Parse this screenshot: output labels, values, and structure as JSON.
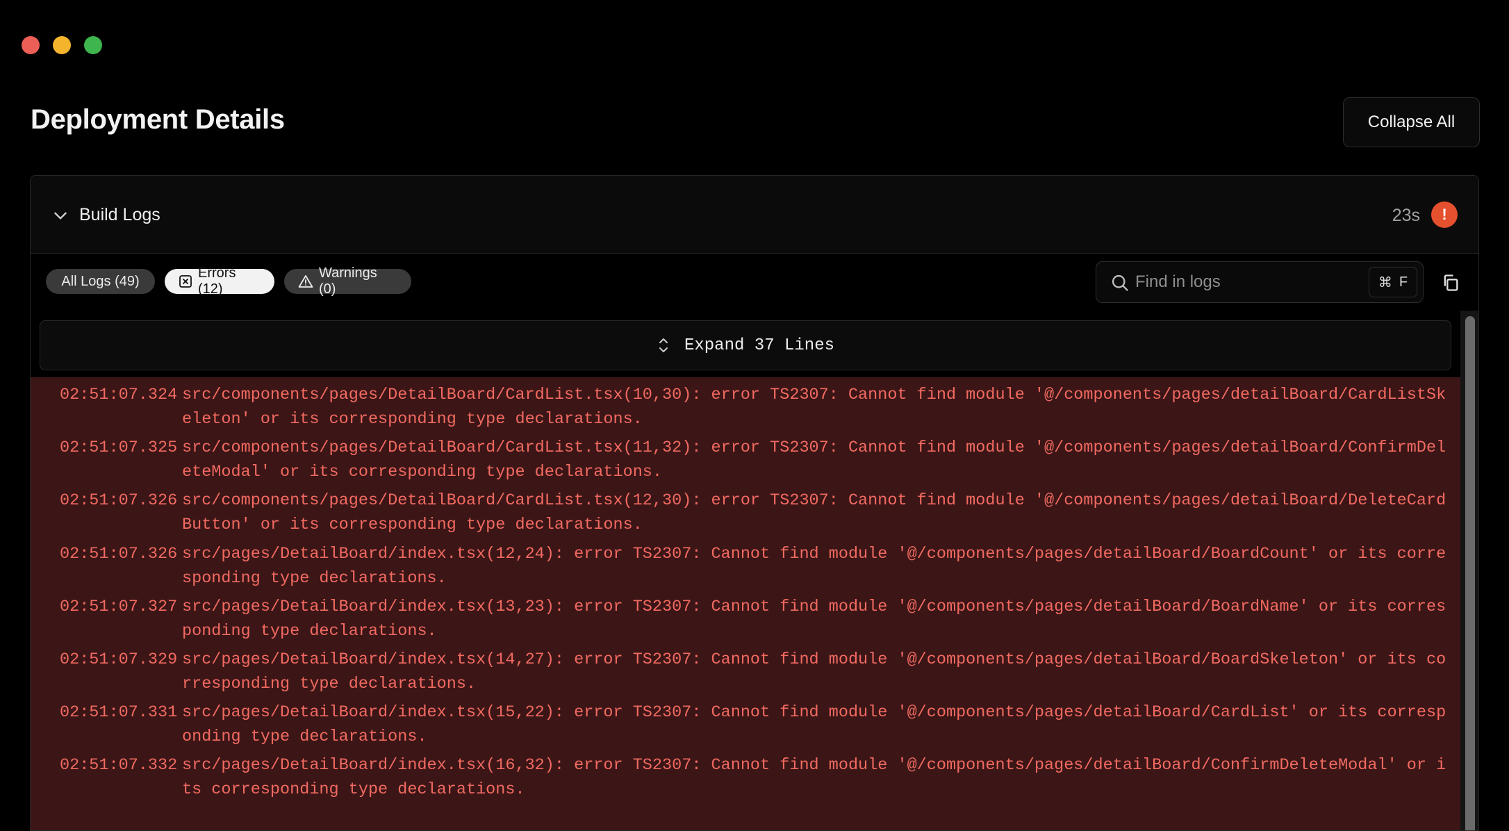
{
  "window": {
    "controls": [
      "close",
      "minimize",
      "zoom"
    ]
  },
  "page": {
    "title": "Deployment Details"
  },
  "toolbar": {
    "collapse_all_label": "Collapse All"
  },
  "panel": {
    "title": "Build Logs",
    "duration": "23s",
    "status_badge": "!",
    "filters": {
      "all_label": "All Logs (49)",
      "errors_label": "Errors (12)",
      "warnings_label": "Warnings (0)"
    },
    "search": {
      "placeholder": "Find in logs",
      "shortcut_cmd": "⌘",
      "shortcut_key": "F"
    },
    "expand_label": "Expand 37 Lines",
    "logs": [
      {
        "time": "02:51:07.324",
        "message": "src/components/pages/DetailBoard/CardList.tsx(10,30): error TS2307: Cannot find module '@/components/pages/detailBoard/CardListSkeleton' or its corresponding type declarations."
      },
      {
        "time": "02:51:07.325",
        "message": "src/components/pages/DetailBoard/CardList.tsx(11,32): error TS2307: Cannot find module '@/components/pages/detailBoard/ConfirmDeleteModal' or its corresponding type declarations."
      },
      {
        "time": "02:51:07.326",
        "message": "src/components/pages/DetailBoard/CardList.tsx(12,30): error TS2307: Cannot find module '@/components/pages/detailBoard/DeleteCardButton' or its corresponding type declarations."
      },
      {
        "time": "02:51:07.326",
        "message": "src/pages/DetailBoard/index.tsx(12,24): error TS2307: Cannot find module '@/components/pages/detailBoard/BoardCount' or its corresponding type declarations."
      },
      {
        "time": "02:51:07.327",
        "message": "src/pages/DetailBoard/index.tsx(13,23): error TS2307: Cannot find module '@/components/pages/detailBoard/BoardName' or its corresponding type declarations."
      },
      {
        "time": "02:51:07.329",
        "message": "src/pages/DetailBoard/index.tsx(14,27): error TS2307: Cannot find module '@/components/pages/detailBoard/BoardSkeleton' or its corresponding type declarations."
      },
      {
        "time": "02:51:07.331",
        "message": "src/pages/DetailBoard/index.tsx(15,22): error TS2307: Cannot find module '@/components/pages/detailBoard/CardList' or its corresponding type declarations."
      },
      {
        "time": "02:51:07.332",
        "message": "src/pages/DetailBoard/index.tsx(16,32): error TS2307: Cannot find module '@/components/pages/detailBoard/ConfirmDeleteModal' or its corresponding type declarations."
      }
    ]
  },
  "colors": {
    "error_text": "#f26a61",
    "error_bg": "#3c1617",
    "badge": "#e5502e"
  }
}
